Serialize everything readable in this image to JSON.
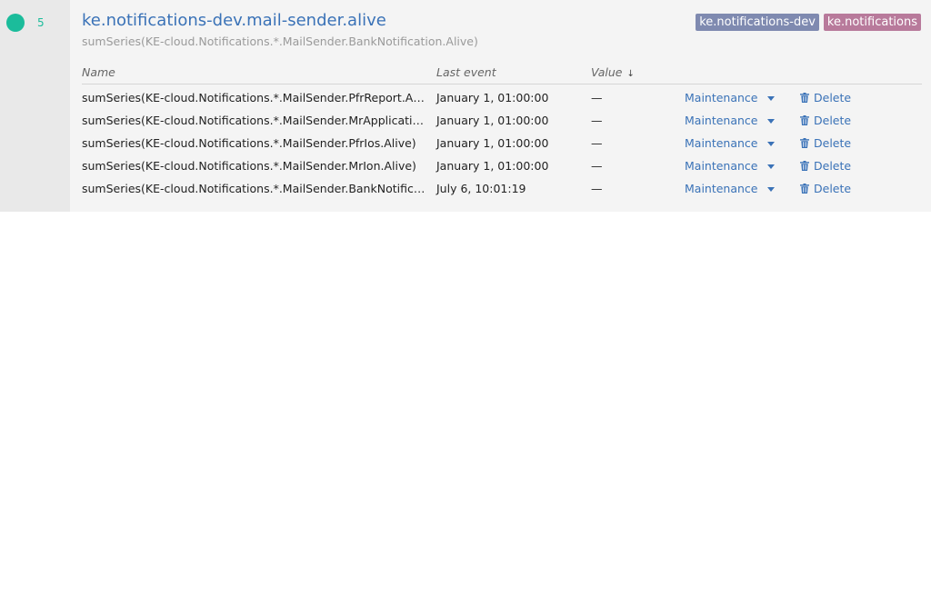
{
  "trigger": {
    "status_count": "5",
    "status_color": "#1bbc9b",
    "title": "ke.notifications-dev.mail-sender.alive",
    "subtitle": "sumSeries(KE-cloud.Notifications.*.MailSender.BankNotification.Alive)",
    "tags": [
      {
        "label": "ke.notifications-dev",
        "color": "#7f8ab0"
      },
      {
        "label": "ke.notifications",
        "color": "#b87a9b"
      }
    ]
  },
  "table": {
    "headers": {
      "name": "Name",
      "last_event": "Last event",
      "value": "Value",
      "sort_icon": "↓"
    },
    "rows": [
      {
        "name": "sumSeries(KE-cloud.Notifications.*.MailSender.PfrReport.Alive)",
        "last_event": "January 1, 01:00:00",
        "value": "—",
        "maintenance": "Maintenance",
        "delete": "Delete"
      },
      {
        "name": "sumSeries(KE-cloud.Notifications.*.MailSender.MrApplication.Alive)",
        "last_event": "January 1, 01:00:00",
        "value": "—",
        "maintenance": "Maintenance",
        "delete": "Delete"
      },
      {
        "name": "sumSeries(KE-cloud.Notifications.*.MailSender.PfrIos.Alive)",
        "last_event": "January 1, 01:00:00",
        "value": "—",
        "maintenance": "Maintenance",
        "delete": "Delete"
      },
      {
        "name": "sumSeries(KE-cloud.Notifications.*.MailSender.MrIon.Alive)",
        "last_event": "January 1, 01:00:00",
        "value": "—",
        "maintenance": "Maintenance",
        "delete": "Delete"
      },
      {
        "name": "sumSeries(KE-cloud.Notifications.*.MailSender.BankNotification.Alive)",
        "last_event": "July 6, 10:01:19",
        "value": "—",
        "maintenance": "Maintenance",
        "delete": "Delete"
      }
    ]
  },
  "icons": {
    "status": "status-dot-icon",
    "sort": "arrow-down-icon",
    "dropdown": "caret-down-icon",
    "delete": "trash-icon"
  }
}
